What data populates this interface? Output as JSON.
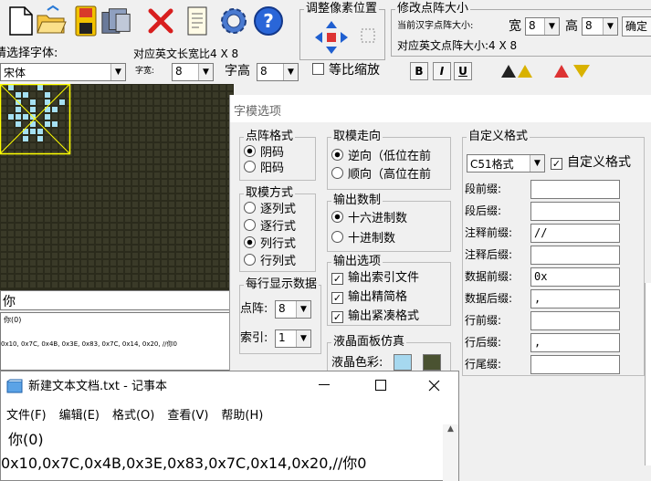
{
  "toolbar": {
    "adjust_pixel_title": "调整像素位置",
    "modify_size_title": "修改点阵大小",
    "current_size_label": "当前汉字点阵大小:",
    "width_label": "宽",
    "width_value": "8",
    "height_label": "高",
    "height_value": "8",
    "modify_btn": "确定",
    "english_size_label": "对应英文点阵大小:4 X 8"
  },
  "font": {
    "choose_label": "请选择字体:",
    "english_width_label": "对应英文长宽比4 X 8",
    "font_value": "宋体",
    "char_width_label": "字宽:",
    "char_width_value": "8",
    "char_height_label": "字高",
    "char_height_value": "8",
    "scale_label": "等比缩放",
    "bold_btn": "B",
    "italic_btn": "I",
    "underline_btn": "U"
  },
  "preview": {
    "input_text": "你",
    "char_label": "你(0)",
    "data_line": "0x10, 0x7C, 0x4B, 0x3E, 0x83, 0x7C, 0x14, 0x20, //你0"
  },
  "dialog": {
    "title": "字模选项",
    "dot_format": {
      "title": "点阵格式",
      "options": [
        "阴码",
        "阳码"
      ],
      "selected": 0
    },
    "mod_direction": {
      "title": "取模走向",
      "options": [
        "逆向（低位在前",
        "顺向（高位在前"
      ],
      "selected": 0
    },
    "mod_method": {
      "title": "取模方式",
      "options": [
        "逐列式",
        "逐行式",
        "列行式",
        "行列式"
      ],
      "selected": 2
    },
    "output_base": {
      "title": "输出数制",
      "options": [
        "十六进制数",
        "十进制数"
      ],
      "selected": 0
    },
    "per_line": {
      "title": "每行显示数据",
      "dots_label": "点阵:",
      "dots_value": "8",
      "index_label": "索引:",
      "index_value": "1"
    },
    "output_options": {
      "title": "输出选项",
      "items": [
        "输出索引文件",
        "输出精简格",
        "输出紧凑格式"
      ]
    },
    "lcd": {
      "title": "液晶面板仿真",
      "color_label": "液晶色彩:"
    },
    "custom": {
      "title": "自定义格式",
      "format_value": "C51格式",
      "custom_chk": "自定义格式",
      "fields": [
        {
          "label": "段前缀:",
          "value": ""
        },
        {
          "label": "段后缀:",
          "value": ""
        },
        {
          "label": "注释前缀:",
          "value": "//"
        },
        {
          "label": "注释后缀:",
          "value": ""
        },
        {
          "label": "数据前缀:",
          "value": "0x"
        },
        {
          "label": "数据后缀:",
          "value": ","
        },
        {
          "label": "行前缀:",
          "value": ""
        },
        {
          "label": "行后缀:",
          "value": ","
        },
        {
          "label": "行尾缀:",
          "value": ""
        }
      ]
    }
  },
  "notepad": {
    "title": "新建文本文档.txt - 记事本",
    "menu": [
      "文件(F)",
      "编辑(E)",
      "格式(O)",
      "查看(V)",
      "帮助(H)"
    ],
    "line1": "你(0)",
    "line2": "0x10,0x7C,0x4B,0x3E,0x83,0x7C,0x14,0x20,//你0"
  },
  "colors": {
    "grid_bg": "#2b2b1c",
    "pixel_on": "#a6e0f2",
    "highlight": "#ffff00",
    "lcd_color": "#a6d8ef",
    "lcd_color2": "#4a5231"
  }
}
